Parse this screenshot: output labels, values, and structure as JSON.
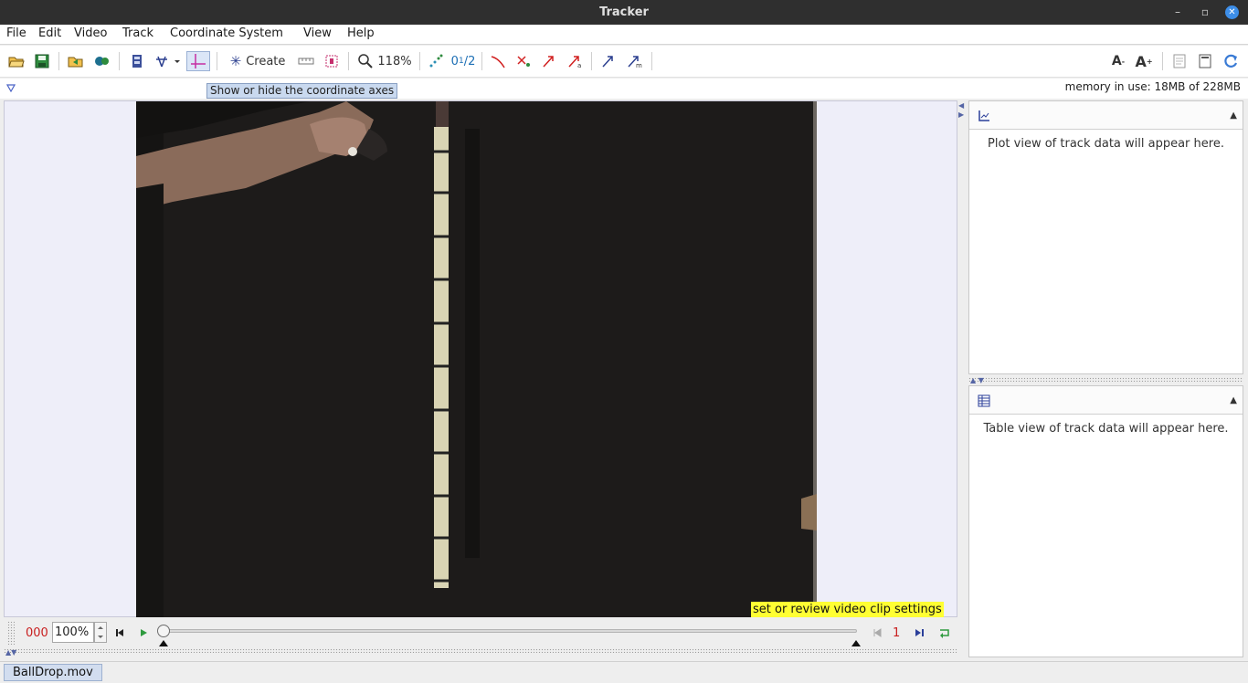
{
  "window": {
    "title": "Tracker",
    "close_glyph": "✕"
  },
  "menu": [
    "File",
    "Edit",
    "Video",
    "Track",
    "Coordinate System",
    "View",
    "Help"
  ],
  "toolbar": {
    "create_label": "Create",
    "zoom_label": "118%",
    "icons": [
      "open-icon",
      "save-icon",
      "open-project-icon",
      "library-icon",
      "clip-settings-icon",
      "calibration-icon",
      "axes-icon",
      "create-track-icon",
      "ruler-icon",
      "mask-icon",
      "zoom-icon",
      "trails-icon",
      "labels-icon",
      "position-icon",
      "velocity-icon",
      "acceleration-icon",
      "momentum-icon",
      "font-smaller-icon",
      "font-larger-icon",
      "notes-icon",
      "properties-icon",
      "refresh-icon"
    ]
  },
  "tooltip": "Show or hide the coordinate axes",
  "memory": "memory in use: 18MB of 228MB",
  "video": {
    "clip_settings_label": "set or review video clip settings"
  },
  "player": {
    "frame_counter": "000",
    "rate": "100%",
    "end_frame": "1",
    "slider_position": 0
  },
  "plot_panel": {
    "message": "Plot view of track data will appear here."
  },
  "table_panel": {
    "message": "Table view of track data will appear here."
  },
  "tabs": [
    "BallDrop.mov"
  ],
  "colors": {
    "frame_red": "#c81e1e",
    "clip_label_bg": "#ffff33",
    "accent_blue": "#3d8ee8"
  }
}
